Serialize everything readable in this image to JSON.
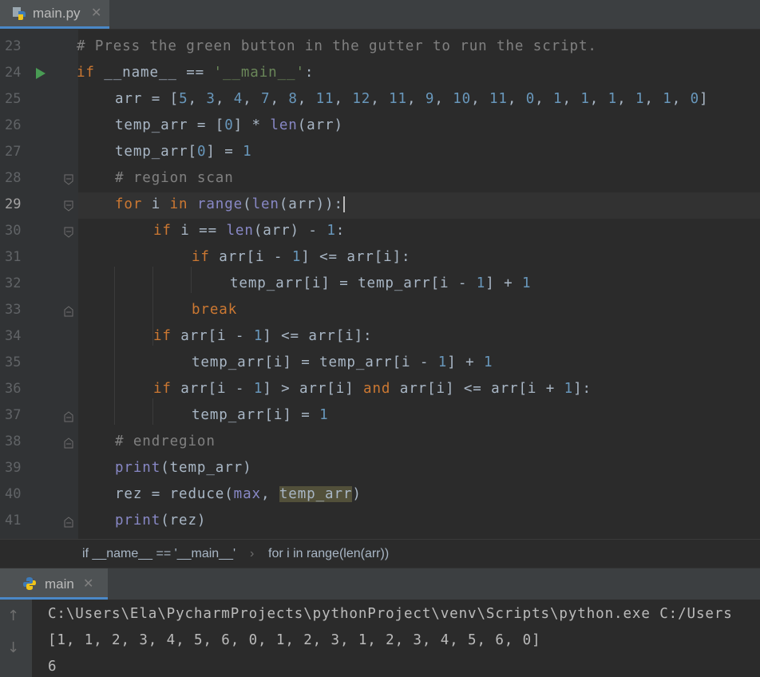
{
  "tabs": {
    "file_tab_label": "main.py"
  },
  "editor": {
    "lines": [
      {
        "n": "23"
      },
      {
        "n": "24"
      },
      {
        "n": "25"
      },
      {
        "n": "26"
      },
      {
        "n": "27"
      },
      {
        "n": "28"
      },
      {
        "n": "29"
      },
      {
        "n": "30"
      },
      {
        "n": "31"
      },
      {
        "n": "32"
      },
      {
        "n": "33"
      },
      {
        "n": "34"
      },
      {
        "n": "35"
      },
      {
        "n": "36"
      },
      {
        "n": "37"
      },
      {
        "n": "38"
      },
      {
        "n": "39"
      },
      {
        "n": "40"
      },
      {
        "n": "41"
      }
    ],
    "code": {
      "l23": "# Press the green button in the gutter to run the script.",
      "l28": "# region scan",
      "l38": "# endregion"
    },
    "current_line": "29"
  },
  "breadcrumb": {
    "item1": "if __name__ == '__main__'",
    "sep": "›",
    "item2": "for i in range(len(arr))"
  },
  "run_window": {
    "tab_label": "main",
    "output": [
      "C:\\Users\\Ela\\PycharmProjects\\pythonProject\\venv\\Scripts\\python.exe C:/Users",
      "[1, 1, 2, 3, 4, 5, 6, 0, 1, 2, 3, 1, 2, 3, 4, 5, 6, 0]",
      "6"
    ]
  },
  "icons": [
    "python-file-icon",
    "close-icon",
    "run-gutter-icon",
    "fold-icon",
    "arrow-up-icon",
    "arrow-down-icon"
  ],
  "colors": {
    "keyword": "#cc7832",
    "number": "#6897bb",
    "string": "#6a8759",
    "comment": "#808080",
    "builtin": "#8888c6",
    "accent": "#4a88c7"
  }
}
